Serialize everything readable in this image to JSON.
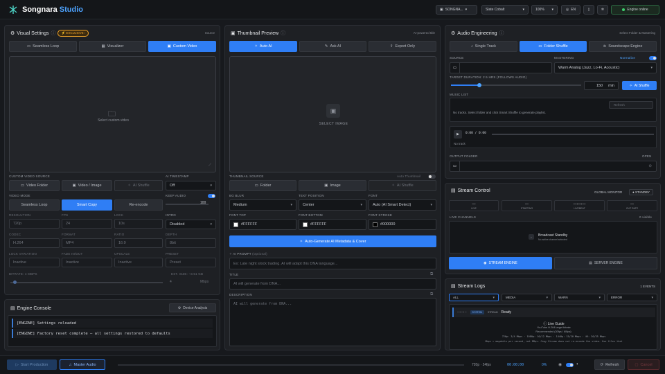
{
  "topbar": {
    "brand": "Songnara",
    "brand_studio": "Studio",
    "channel": "SONGNA...",
    "theme": "Slate Cobalt",
    "zoom": "100%",
    "lang": "EN",
    "engine": "Engine online"
  },
  "visual": {
    "title": "Visual Settings",
    "badge": "EXCLUSIVE",
    "note": "Source",
    "tabs": [
      "Seamless Loop",
      "Visualizer",
      "Custom Video"
    ],
    "drop_text": "Select custom video",
    "custom_source_label": "CUSTOM VIDEO SOURCE",
    "src_buttons": [
      "Video Folder",
      "Video / Image",
      "AI Shuffle"
    ],
    "ai_timestamp_label": "AI TIMESTAMP",
    "ai_timestamp_value": "Off",
    "video_mode_label": "VIDEO MODE",
    "modes": [
      "Seamless Loop",
      "Smart Copy",
      "Re-encode"
    ],
    "keep_audio_label": "KEEP AUDIO",
    "keep_audio_value": "100",
    "row1_labels": [
      "RESOLUTION",
      "FPS",
      "LOCK"
    ],
    "row1_values": [
      "720p",
      "24",
      "10s"
    ],
    "intro_label": "INTRO",
    "intro_value": "Disabled",
    "row2_labels": [
      "CODEC",
      "FORMAT",
      "RATIO",
      "DEPTH"
    ],
    "row2_values": [
      "H.264",
      "MP4",
      "16:9",
      "8bit"
    ],
    "row3_labels": [
      "LOCK VARIATION",
      "FADE IN/OUT",
      "UPSCALE",
      "PRESET"
    ],
    "row3_values": [
      "Inactive",
      "Inactive",
      "Inactive",
      "Preset"
    ],
    "bitrate_label": "BITRATE: 4 MBPS",
    "bitrate_note": "EST. SIZE: ~3.51 GB",
    "bitrate_value": "4",
    "bitrate_unit": "Mbps"
  },
  "console": {
    "title": "Engine Console",
    "device_button": "Device Analysis",
    "lines": [
      "[ENGINE] Settings reloaded",
      "[ENGINE] Factory reset complete — all settings restored to defaults"
    ]
  },
  "thumb": {
    "title": "Thumbnail Preview",
    "note": "AI-powered title",
    "tabs": [
      "Auto AI",
      "Ask AI",
      "Export Only"
    ],
    "drop_text": "SELECT IMAGE",
    "source_label": "THUMBNAIL SOURCE",
    "auto_label": "Auto Thumbnail",
    "src_buttons": [
      "Folder",
      "Image",
      "AI Shuffle"
    ],
    "bg_blur_label": "BG BLUR",
    "bg_blur_value": "Medium",
    "text_pos_label": "TEXT POSITION",
    "text_pos_value": "Center",
    "font_label": "FONT",
    "font_value": "Auto (AI Smart Detect)",
    "font_top_label": "FONT TOP",
    "font_top_value": "#FFFFFF",
    "font_bottom_label": "FONT BOTTOM",
    "font_bottom_value": "#FFFFFF",
    "font_stroke_label": "FONT STROKE",
    "font_stroke_value": "#000000",
    "generate_button": "Auto-Generate AI Metadata & Cover",
    "prompt_label": "AI PROMPT",
    "prompt_optional": "(Optional)",
    "prompt_placeholder": "Ex: Late night stock trading. AI will adapt this DNA language...",
    "title_label": "TITLE",
    "title_placeholder": "AI will generate from DNA...",
    "desc_label": "DESCRIPTION",
    "desc_placeholder": "AI will generate from DNA..."
  },
  "audio": {
    "title": "Audio Engineering",
    "note": "Select Folder & Mastering",
    "tabs": [
      "Single Track",
      "Folder Shuffle",
      "Soundscape Engine"
    ],
    "source_label": "SOURCE",
    "mastering_label": "MASTERING",
    "mastering_toggle": "Normalize",
    "mastering_value": "Warm Analog (Jazz, Lo-Fi, Acoustic)",
    "duration_label": "TARGET DURATION: 2.5 HRS (FOLLOWS AUDIO)",
    "duration_value": "150",
    "duration_unit": "min",
    "duration_fraction": 0.22,
    "ai_shuffle": "AI Shuffle",
    "music_list_label": "MUSIC LIST",
    "refresh_btn": "Refresh",
    "empty_list": "No tracks. Select folder and click Smart Shuffle to generate playlist.",
    "player_time": "0:00 / 0:00",
    "no_track": "No track",
    "output_label": "OUTPUT FOLDER",
    "open_label": "OPEN"
  },
  "stream": {
    "title": "Stream Control",
    "global": "GLOBAL MONITOR",
    "standby": "STANDBY",
    "cards": [
      {
        "v": "—",
        "k": "LIVE"
      },
      {
        "v": "—",
        "k": "STARTING"
      },
      {
        "v": "—:—:—",
        "k": "LIVEBEAT"
      },
      {
        "v": "—",
        "k": "OUT RATE"
      }
    ],
    "channels_label": "LIVE CHANNELS",
    "channels_count": "0 visible",
    "broadcast": "Broadcast Standby",
    "broadcast_sub": "No active channel selected",
    "stream_engine": "STREAM ENGINE",
    "server_engine": "SERVER ENGINE"
  },
  "logs": {
    "title": "Stream Logs",
    "count": "1 EVENTS",
    "filters": [
      "ALL",
      "MEDIA",
      "WARN",
      "ERROR"
    ],
    "entry_time": "—:—:—",
    "entry_tag": "SYSTEM",
    "entry_src": "STREAM",
    "entry_msg": "Ready",
    "guide_title": "Live Guide",
    "guide_sub": "YouTube H.264 target bitrate",
    "guide_rec": "Recommended (30fps / 60fps):",
    "guide_rates": "720p: 3/4 Mbps · 1080p: 10/12 Mbps · 1440p: 15/20 Mbps · 4K: 30/35 Mbps",
    "guide_note": "Mbps = megabits per second, not MBps. Copy Stream does not re-encode the video. Use files that"
  },
  "bottom": {
    "start": "Start Production",
    "master": "Master Audio",
    "status": "720p · 24fps",
    "timer": "00:00:00",
    "pct": "0%",
    "refresh": "Refresh",
    "cancel": "Cancel"
  },
  "colors": {
    "accent": "#2f7ef5",
    "badge": "#f0a429",
    "online": "#3ecf6e"
  }
}
